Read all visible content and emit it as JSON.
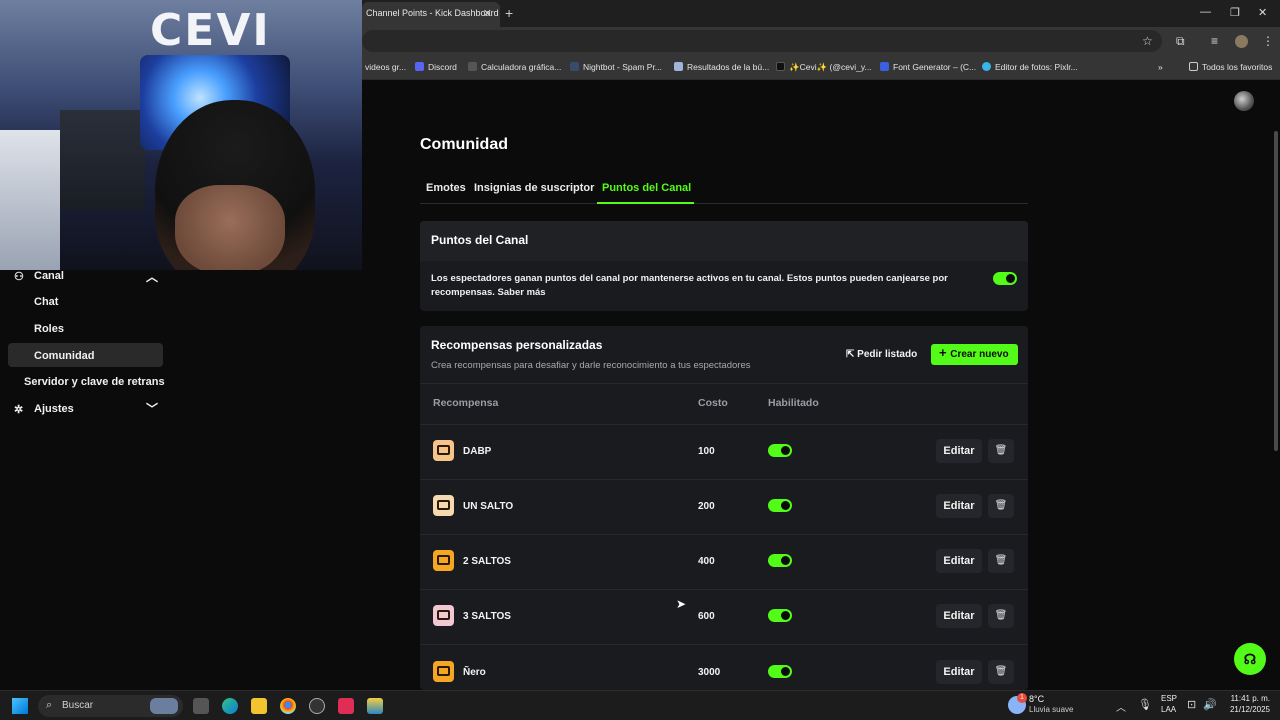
{
  "browser": {
    "tab_title": "Channel Points - Kick Dashboard",
    "bookmarks": [
      "videos gr...",
      "Discord",
      "Calculadora gráfica...",
      "Nightbot - Spam Pr...",
      "Resultados de la bú...",
      "✨Cevi✨ (@cevi_y...",
      "Font Generator – (C...",
      "Editor de fotos: Pixlr...",
      "Todos los favoritos"
    ]
  },
  "webcam": {
    "logo_text": "CEVI"
  },
  "sidebar": {
    "section": "Canal",
    "items": [
      "Chat",
      "Roles",
      "Comunidad"
    ],
    "server_key": "Servidor y clave de retrans",
    "settings": "Ajustes"
  },
  "page": {
    "title": "Comunidad",
    "tabs": [
      "Emotes",
      "Insignias de suscriptor",
      "Puntos del Canal"
    ]
  },
  "points_card": {
    "title": "Puntos del Canal",
    "description": "Los espectadores ganan puntos del canal por mantenerse activos en tu canal. Estos puntos pueden canjearse por recompensas. Saber más",
    "enabled": true
  },
  "rewards_card": {
    "title": "Recompensas personalizadas",
    "subtitle": "Crea recompensas para desafiar y darle reconocimiento a tus espectadores",
    "list_button": "Pedir listado",
    "create_button": "Crear nuevo",
    "columns": [
      "Recompensa",
      "Costo",
      "Habilitado"
    ],
    "edit_label": "Editar",
    "rewards": [
      {
        "name": "DABP",
        "cost": "100",
        "enabled": true,
        "color": "#f6c48a"
      },
      {
        "name": "UN SALTO",
        "cost": "200",
        "enabled": true,
        "color": "#f7d9b0"
      },
      {
        "name": "2 SALTOS",
        "cost": "400",
        "enabled": true,
        "color": "#f5a623"
      },
      {
        "name": "3 SALTOS",
        "cost": "600",
        "enabled": true,
        "color": "#f3c6d4"
      },
      {
        "name": "Ñero",
        "cost": "3000",
        "enabled": true,
        "color": "#f5a623"
      }
    ]
  },
  "taskbar": {
    "search_placeholder": "Buscar",
    "weather_temp": "8°C",
    "weather_desc": "Lluvia suave",
    "lang_top": "ESP",
    "lang_bottom": "LAA",
    "time": "11:41 p. m.",
    "date": "21/12/2025",
    "notification_count": "1"
  },
  "colors": {
    "accent": "#53fc18"
  }
}
